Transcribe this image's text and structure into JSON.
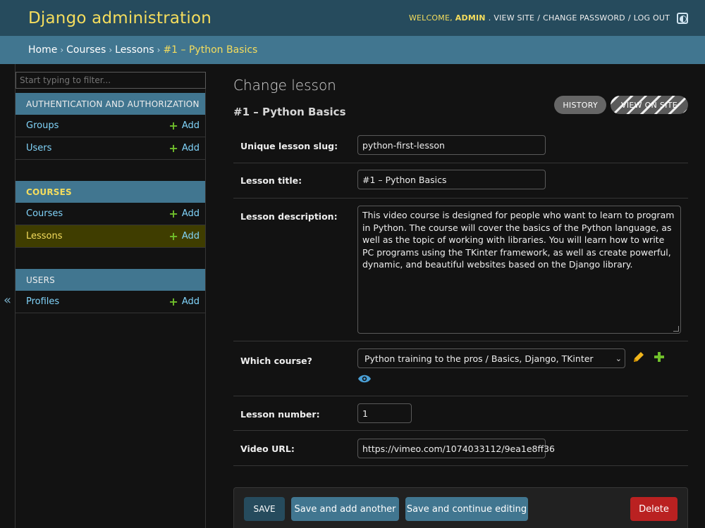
{
  "header": {
    "brand": "Django administration",
    "welcome": "Welcome,",
    "username": "admin",
    "links": [
      "View site",
      "Change password",
      "Log out"
    ]
  },
  "breadcrumbs": {
    "items": [
      "Home",
      "Courses",
      "Lessons"
    ],
    "current": "#1 – Python Basics"
  },
  "sidebar": {
    "filter_placeholder": "Start typing to filter...",
    "toggle_glyph": "«",
    "add_label": "Add",
    "modules": [
      {
        "caption": "Authentication and Authorization",
        "models": [
          "Groups",
          "Users"
        ]
      },
      {
        "caption": "Courses",
        "models": [
          "Courses",
          "Lessons"
        ]
      },
      {
        "caption": "Users",
        "models": [
          "Profiles"
        ]
      }
    ]
  },
  "content": {
    "page_title": "Change lesson",
    "object_title": "#1 – Python Basics",
    "tools": {
      "history": "History",
      "view_on_site": "View on site"
    },
    "fields": {
      "slug": {
        "label": "Unique lesson slug:",
        "value": "python-first-lesson"
      },
      "title": {
        "label": "Lesson title:",
        "value": "#1 – Python Basics"
      },
      "description": {
        "label": "Lesson description:",
        "value": "This video course is designed for people who want to learn to program in Python. The course will cover the basics of the Python language, as well as the topic of working with libraries. You will learn how to write PC programs using the TKinter framework, as well as create powerful, dynamic, and beautiful websites based on the Django library."
      },
      "course": {
        "label": "Which course?",
        "value": "Python training to the pros / Basics, Django, TKinter"
      },
      "number": {
        "label": "Lesson number:",
        "value": "1"
      },
      "video_url": {
        "label": "Video URL:",
        "value": "https://vimeo.com/1074033112/9ea1e8ff36"
      }
    }
  },
  "submit": {
    "save": "SAVE",
    "save_add": "Save and add another",
    "save_continue": "Save and continue editing",
    "delete": "Delete"
  },
  "colors": {
    "header_bg": "#264b5d",
    "breadcrumb_bg": "#417690",
    "accent_yellow": "#f5dd5d",
    "link_blue": "#81d4fa",
    "add_green": "#70bf2b",
    "delete_red": "#ba2121",
    "edit_yellow": "#f0b51c"
  },
  "icons": {
    "theme_toggle": "theme-toggle-icon",
    "add": "plus-icon",
    "change": "pencil-icon",
    "add_related": "plus-icon",
    "view_related": "eye-icon"
  }
}
